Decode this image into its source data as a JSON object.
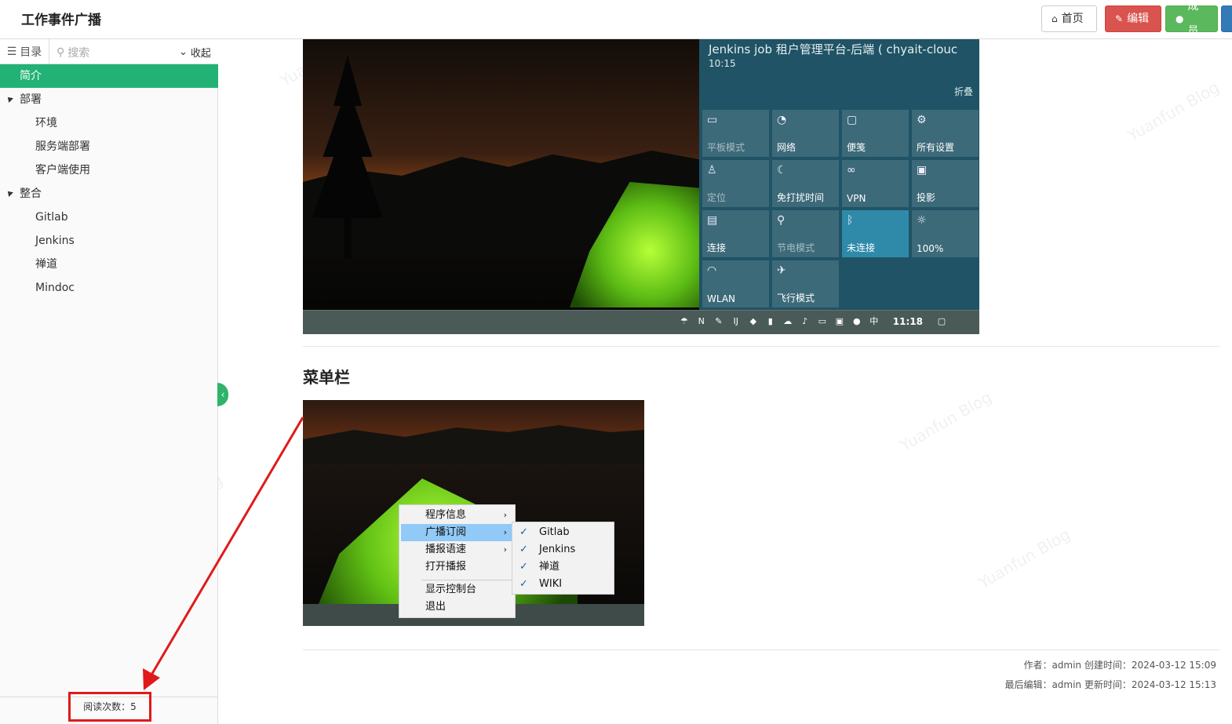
{
  "header": {
    "title": "工作事件广播",
    "home_label": "首页",
    "edit_label": "编辑",
    "member_label": "成员"
  },
  "sidebar": {
    "toc_label": "目录",
    "search_placeholder": "搜索",
    "collapse_label": "收起",
    "items": [
      {
        "label": "简介",
        "level": 0,
        "active": true
      },
      {
        "label": "部署",
        "level": 1
      },
      {
        "label": "环境",
        "level": 2
      },
      {
        "label": "服务端部署",
        "level": 2
      },
      {
        "label": "客户端使用",
        "level": 2
      },
      {
        "label": "整合",
        "level": 1
      },
      {
        "label": "Gitlab",
        "level": 2
      },
      {
        "label": "Jenkins",
        "level": 2
      },
      {
        "label": "禅道",
        "level": 2
      },
      {
        "label": "Mindoc",
        "level": 2
      }
    ],
    "read_count": "阅读次数：5"
  },
  "screenshot1": {
    "notification_title": "Jenkins job 租户管理平台-后端 ( chyait-clouc",
    "notification_time": "10:15",
    "fold_label": "折叠",
    "tiles": [
      {
        "label": "平板模式",
        "icon": "tablet-icon",
        "state": "dim"
      },
      {
        "label": "网络",
        "icon": "network-icon",
        "state": "normal"
      },
      {
        "label": "便笺",
        "icon": "note-icon",
        "state": "normal"
      },
      {
        "label": "所有设置",
        "icon": "gear-icon",
        "state": "normal"
      },
      {
        "label": "定位",
        "icon": "location-icon",
        "state": "dim"
      },
      {
        "label": "免打扰时间",
        "icon": "moon-icon",
        "state": "normal"
      },
      {
        "label": "VPN",
        "icon": "vpn-icon",
        "state": "normal"
      },
      {
        "label": "投影",
        "icon": "project-icon",
        "state": "normal"
      },
      {
        "label": "连接",
        "icon": "connect-icon",
        "state": "normal"
      },
      {
        "label": "节电模式",
        "icon": "battery-saver-icon",
        "state": "dim"
      },
      {
        "label": "未连接",
        "icon": "bluetooth-icon",
        "state": "on"
      },
      {
        "label": "100%",
        "icon": "brightness-icon",
        "state": "normal"
      },
      {
        "label": "WLAN",
        "icon": "wifi-icon",
        "state": "normal"
      },
      {
        "label": "飞行模式",
        "icon": "airplane-icon",
        "state": "normal"
      }
    ],
    "clock": "11:18",
    "ime": "中"
  },
  "section_heading": "菜单栏",
  "screenshot2": {
    "menu": [
      {
        "label": "程序信息",
        "submenu": true
      },
      {
        "label": "广播订阅",
        "submenu": true,
        "selected": true
      },
      {
        "label": "播报语速",
        "submenu": true
      },
      {
        "label": "打开播报",
        "submenu": false
      },
      {
        "label": "显示控制台",
        "submenu": false
      },
      {
        "label": "退出",
        "submenu": false
      }
    ],
    "submenu": [
      "Gitlab",
      "Jenkins",
      "禅道",
      "WIKI"
    ]
  },
  "meta": {
    "line1": "作者：admin  创建时间：2024-03-12 15:09",
    "line2": "最后编辑：admin  更新时间：2024-03-12 15:13"
  },
  "colors": {
    "accent": "#22b276",
    "edit": "#d9534f",
    "member": "#5cb85c",
    "annotation": "#e01a1a"
  }
}
